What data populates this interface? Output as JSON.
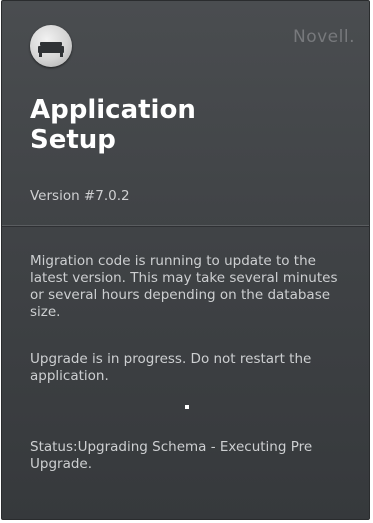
{
  "app": {
    "brand": "Novell.",
    "title_line1": "Application",
    "title_line2": "Setup",
    "version": "Version #7.0.2",
    "logo_icon": "bed-icon"
  },
  "messages": {
    "migration": "Migration code is running to update to the latest version. This may take several minutes or several hours depending on the database size.",
    "upgrade": "Upgrade is in progress. Do not restart the application.",
    "status": "Status:Upgrading Schema - Executing Pre Upgrade."
  },
  "colors": {
    "panel_top": "#4a4d50",
    "panel_bottom": "#36393c",
    "title": "#ffffff",
    "brand": "#77797c"
  }
}
